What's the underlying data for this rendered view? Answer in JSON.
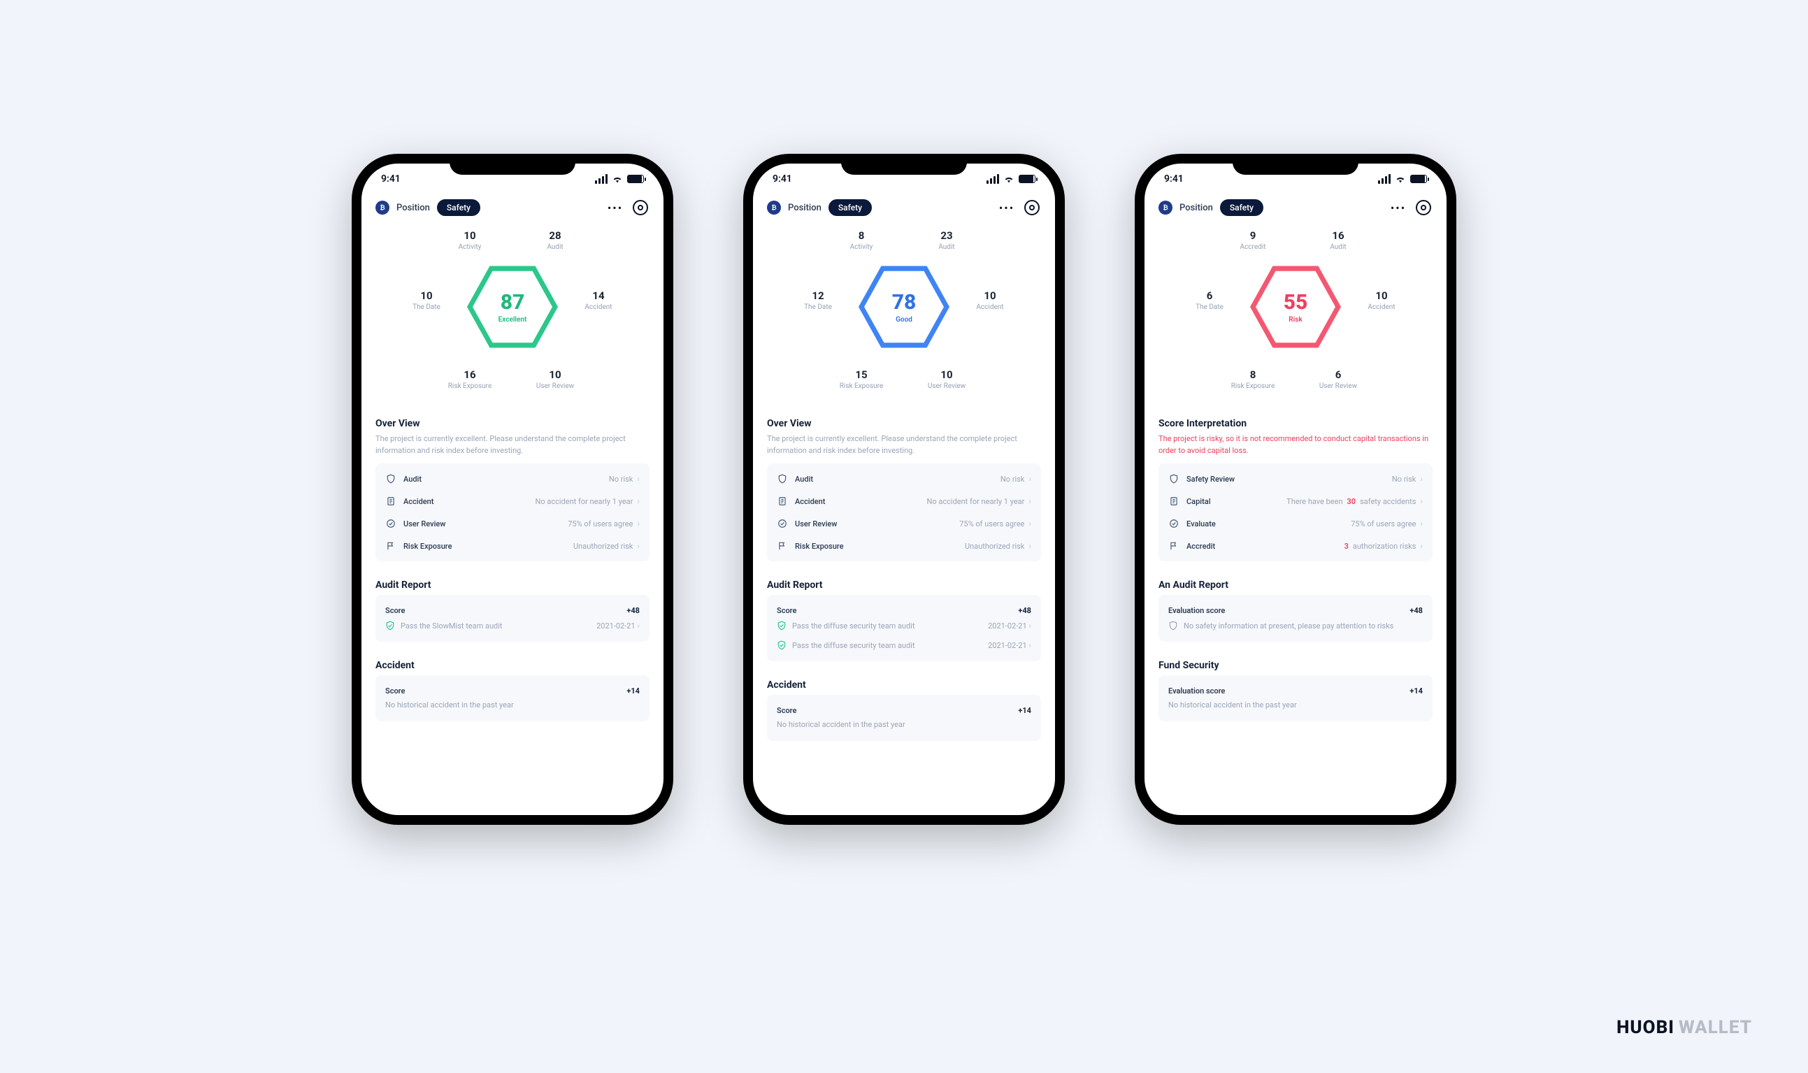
{
  "brand": {
    "strong": "HUOBI",
    "light": "WALLET"
  },
  "statusTime": "9:41",
  "tabs": {
    "position": "Position",
    "safety": "Safety"
  },
  "phones": [
    {
      "variant": "green",
      "score": {
        "value": "87",
        "label": "Excellent"
      },
      "stats": {
        "tl": {
          "num": "10",
          "lbl": "Activity"
        },
        "tr": {
          "num": "28",
          "lbl": "Audit"
        },
        "ml": {
          "num": "10",
          "lbl": "The Date"
        },
        "mr": {
          "num": "14",
          "lbl": "Accident"
        },
        "bl": {
          "num": "16",
          "lbl": "Risk Exposure"
        },
        "br": {
          "num": "10",
          "lbl": "User Review"
        }
      },
      "overview": {
        "title": "Over View",
        "desc": "The project is currently excellent. Please understand the complete project information and risk index before investing.",
        "warn": false,
        "rows": [
          {
            "icon": "shield",
            "label": "Audit",
            "value": "No risk"
          },
          {
            "icon": "clipboard",
            "label": "Accident",
            "value": "No accident for nearly 1 year"
          },
          {
            "icon": "check-circle",
            "label": "User Review",
            "value": "75% of users agree"
          },
          {
            "icon": "flag",
            "label": "Risk Exposure",
            "value": "Unauthorized risk"
          }
        ]
      },
      "audit": {
        "title": "Audit Report",
        "scoreLabel": "Score",
        "scoreValue": "+48",
        "items": [
          {
            "text": "Pass the SlowMist team audit",
            "date": "2021-02-21"
          }
        ]
      },
      "accident": {
        "title": "Accident",
        "scoreLabel": "Score",
        "scoreValue": "+14",
        "sub": "No historical accident in the past year"
      }
    },
    {
      "variant": "blue",
      "score": {
        "value": "78",
        "label": "Good"
      },
      "stats": {
        "tl": {
          "num": "8",
          "lbl": "Activity"
        },
        "tr": {
          "num": "23",
          "lbl": "Audit"
        },
        "ml": {
          "num": "12",
          "lbl": "The Date"
        },
        "mr": {
          "num": "10",
          "lbl": "Accident"
        },
        "bl": {
          "num": "15",
          "lbl": "Risk Exposure"
        },
        "br": {
          "num": "10",
          "lbl": "User Review"
        }
      },
      "overview": {
        "title": "Over View",
        "desc": "The project is currently excellent. Please understand the complete project information and risk index before investing.",
        "warn": false,
        "rows": [
          {
            "icon": "shield",
            "label": "Audit",
            "value": "No risk"
          },
          {
            "icon": "clipboard",
            "label": "Accident",
            "value": "No accident for nearly 1 year"
          },
          {
            "icon": "check-circle",
            "label": "User Review",
            "value": "75% of users agree"
          },
          {
            "icon": "flag",
            "label": "Risk Exposure",
            "value": "Unauthorized risk"
          }
        ]
      },
      "audit": {
        "title": "Audit Report",
        "scoreLabel": "Score",
        "scoreValue": "+48",
        "items": [
          {
            "text": "Pass the diffuse security team audit",
            "date": "2021-02-21"
          },
          {
            "text": "Pass the diffuse security team audit",
            "date": "2021-02-21"
          }
        ]
      },
      "accident": {
        "title": "Accident",
        "scoreLabel": "Score",
        "scoreValue": "+14",
        "sub": "No historical accident in the past year"
      }
    },
    {
      "variant": "red",
      "score": {
        "value": "55",
        "label": "Risk"
      },
      "stats": {
        "tl": {
          "num": "9",
          "lbl": "Accredit"
        },
        "tr": {
          "num": "16",
          "lbl": "Audit"
        },
        "ml": {
          "num": "6",
          "lbl": "The Date"
        },
        "mr": {
          "num": "10",
          "lbl": "Accident"
        },
        "bl": {
          "num": "8",
          "lbl": "Risk Exposure"
        },
        "br": {
          "num": "6",
          "lbl": "User Review"
        }
      },
      "overview": {
        "title": "Score Interpretation",
        "desc": "The project is risky, so it is not recommended to conduct capital transactions in order to avoid capital loss.",
        "warn": true,
        "rows": [
          {
            "icon": "shield",
            "label": "Safety Review",
            "value": "No risk"
          },
          {
            "icon": "clipboard",
            "label": "Capital",
            "valuePre": "There have been ",
            "valueNum": "30",
            "valuePost": " safety accidents"
          },
          {
            "icon": "check-circle",
            "label": "Evaluate",
            "value": "75% of users agree"
          },
          {
            "icon": "flag",
            "label": "Accredit",
            "valueNum": "3",
            "valuePost": " authorization risks"
          }
        ]
      },
      "audit": {
        "title": "An Audit Report",
        "scoreLabel": "Evaluation score",
        "scoreValue": "+48",
        "infoLine": "No safety information at present, please pay attention to risks"
      },
      "fund": {
        "title": "Fund Security",
        "scoreLabel": "Evaluation score",
        "scoreValue": "+14",
        "sub": "No historical accident in the past year"
      }
    }
  ]
}
